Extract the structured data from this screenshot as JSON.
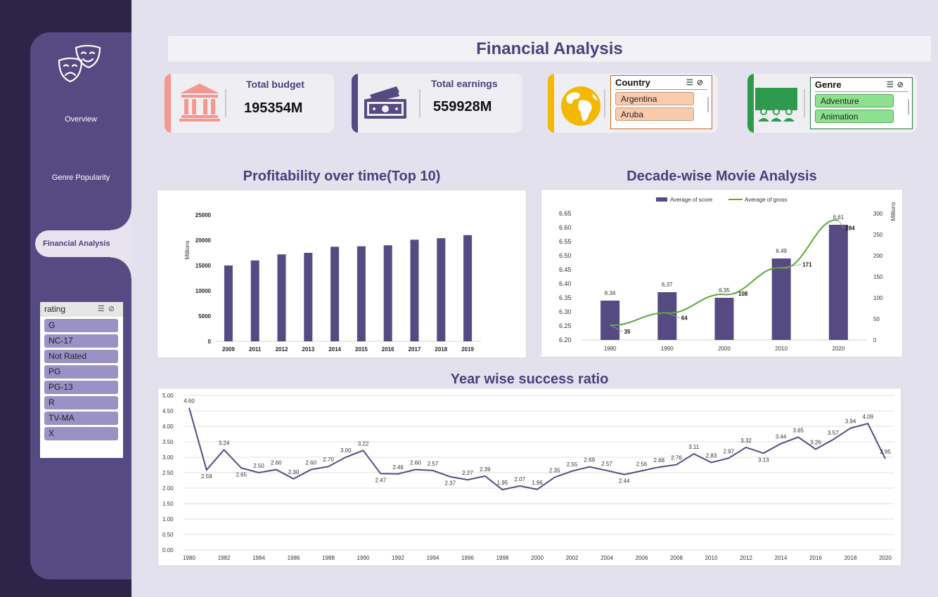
{
  "nav": {
    "overview": "Overview",
    "genre_popularity": "Genre Popularity",
    "financial_analysis": "Financial Analysis"
  },
  "rating_slicer": {
    "header": "rating",
    "items": [
      "G",
      "NC-17",
      "Not Rated",
      "PG",
      "PG-13",
      "R",
      "TV-MA",
      "X"
    ]
  },
  "page": {
    "title": "Financial Analysis"
  },
  "kpis": {
    "budget": {
      "label": "Total budget",
      "value": "195354M"
    },
    "earnings": {
      "label": "Total earnings",
      "value": "559928M"
    }
  },
  "country_slicer": {
    "header": "Country",
    "items": [
      "Argentina",
      "Aruba"
    ]
  },
  "genre_slicer": {
    "header": "Genre",
    "items": [
      "Adventure",
      "Animation"
    ]
  },
  "colors": {
    "primary": "#564a82",
    "budget_accent": "#f4978e",
    "earnings_accent": "#564a82",
    "country_accent": "#f5b800",
    "genre_accent": "#2e9a4d",
    "country_item": "#f8cbad",
    "genre_item": "#8ce08f",
    "line_green": "#59a838"
  },
  "chart_data": [
    {
      "type": "bar",
      "title": "Profitability over time(Top 10)",
      "ylabel": "Millions",
      "categories": [
        "2009",
        "2011",
        "2012",
        "2013",
        "2014",
        "2015",
        "2016",
        "2017",
        "2018",
        "2019"
      ],
      "values": [
        15000,
        16000,
        17200,
        17500,
        18700,
        18800,
        19000,
        20100,
        20400,
        21000
      ],
      "ylim": [
        0,
        25000
      ],
      "yticks": [
        "0",
        "5000",
        "10000",
        "15000",
        "20000",
        "25000"
      ]
    },
    {
      "type": "bar",
      "title": "Decade-wise Movie Analysis",
      "categories": [
        "1980",
        "1990",
        "2000",
        "2010",
        "2020"
      ],
      "ylabel_secondary": "Millions",
      "legend": "top",
      "series": [
        {
          "name": "Average of score",
          "values": [
            6.34,
            6.37,
            6.35,
            6.49,
            6.61
          ],
          "labels": [
            "6.34",
            "6.37",
            "6.35",
            "6.49",
            "6.61"
          ]
        },
        {
          "name": "Average of gross",
          "type": "line",
          "values": [
            35,
            64,
            108,
            171,
            284
          ],
          "labels": [
            "35",
            "64",
            "108",
            "171",
            "284"
          ]
        }
      ],
      "ylim": [
        6.2,
        6.65
      ],
      "yticks": [
        "6.20",
        "6.25",
        "6.30",
        "6.35",
        "6.40",
        "6.45",
        "6.50",
        "6.55",
        "6.60",
        "6.65"
      ],
      "y2lim": [
        0,
        300
      ],
      "y2ticks": [
        "0",
        "50",
        "100",
        "150",
        "200",
        "250",
        "300"
      ]
    },
    {
      "type": "line",
      "title": "Year wise success ratio",
      "x": [
        1980,
        1981,
        1982,
        1983,
        1984,
        1985,
        1986,
        1987,
        1988,
        1989,
        1990,
        1991,
        1992,
        1993,
        1994,
        1995,
        1996,
        1997,
        1998,
        1999,
        2000,
        2001,
        2002,
        2003,
        2004,
        2005,
        2006,
        2007,
        2008,
        2009,
        2010,
        2011,
        2012,
        2013,
        2014,
        2015,
        2016,
        2017,
        2018,
        2019,
        2020
      ],
      "values": [
        4.6,
        2.59,
        3.24,
        2.65,
        2.5,
        2.6,
        2.3,
        2.6,
        2.7,
        3.0,
        3.22,
        2.47,
        2.46,
        2.6,
        2.57,
        2.37,
        2.27,
        2.39,
        1.95,
        2.07,
        1.96,
        2.35,
        2.55,
        2.69,
        2.57,
        2.44,
        2.56,
        2.68,
        2.76,
        3.11,
        2.83,
        2.97,
        3.32,
        3.13,
        3.44,
        3.65,
        3.26,
        3.57,
        3.94,
        4.09,
        2.95
      ],
      "labels": [
        "4.60",
        "2.59",
        "3.24",
        "2.65",
        "2.50",
        "2.60",
        "2.30",
        "2.60",
        "2.70",
        "3.00",
        "3.22",
        "2.47",
        "2.46",
        "2.60",
        "2.57",
        "2.37",
        "2.27",
        "2.39",
        "1.95",
        "2.07",
        "1.96",
        "2.35",
        "2.55",
        "2.69",
        "2.57",
        "2.44",
        "2.56",
        "2.68",
        "2.76",
        "3.11",
        "2.83",
        "2.97",
        "3.32",
        "3.13",
        "3.44",
        "3.65",
        "3.26",
        "3.57",
        "3.94",
        "4.09",
        "2.95"
      ],
      "xticks": [
        "1980",
        "1982",
        "1984",
        "1986",
        "1988",
        "1990",
        "1992",
        "1994",
        "1996",
        "1998",
        "2000",
        "2002",
        "2004",
        "2006",
        "2008",
        "2010",
        "2012",
        "2014",
        "2016",
        "2018",
        "2020"
      ],
      "ylim": [
        0,
        5
      ],
      "yticks": [
        "0.00",
        "0.50",
        "1.00",
        "1.50",
        "2.00",
        "2.50",
        "3.00",
        "3.50",
        "4.00",
        "4.50",
        "5.00"
      ]
    }
  ]
}
